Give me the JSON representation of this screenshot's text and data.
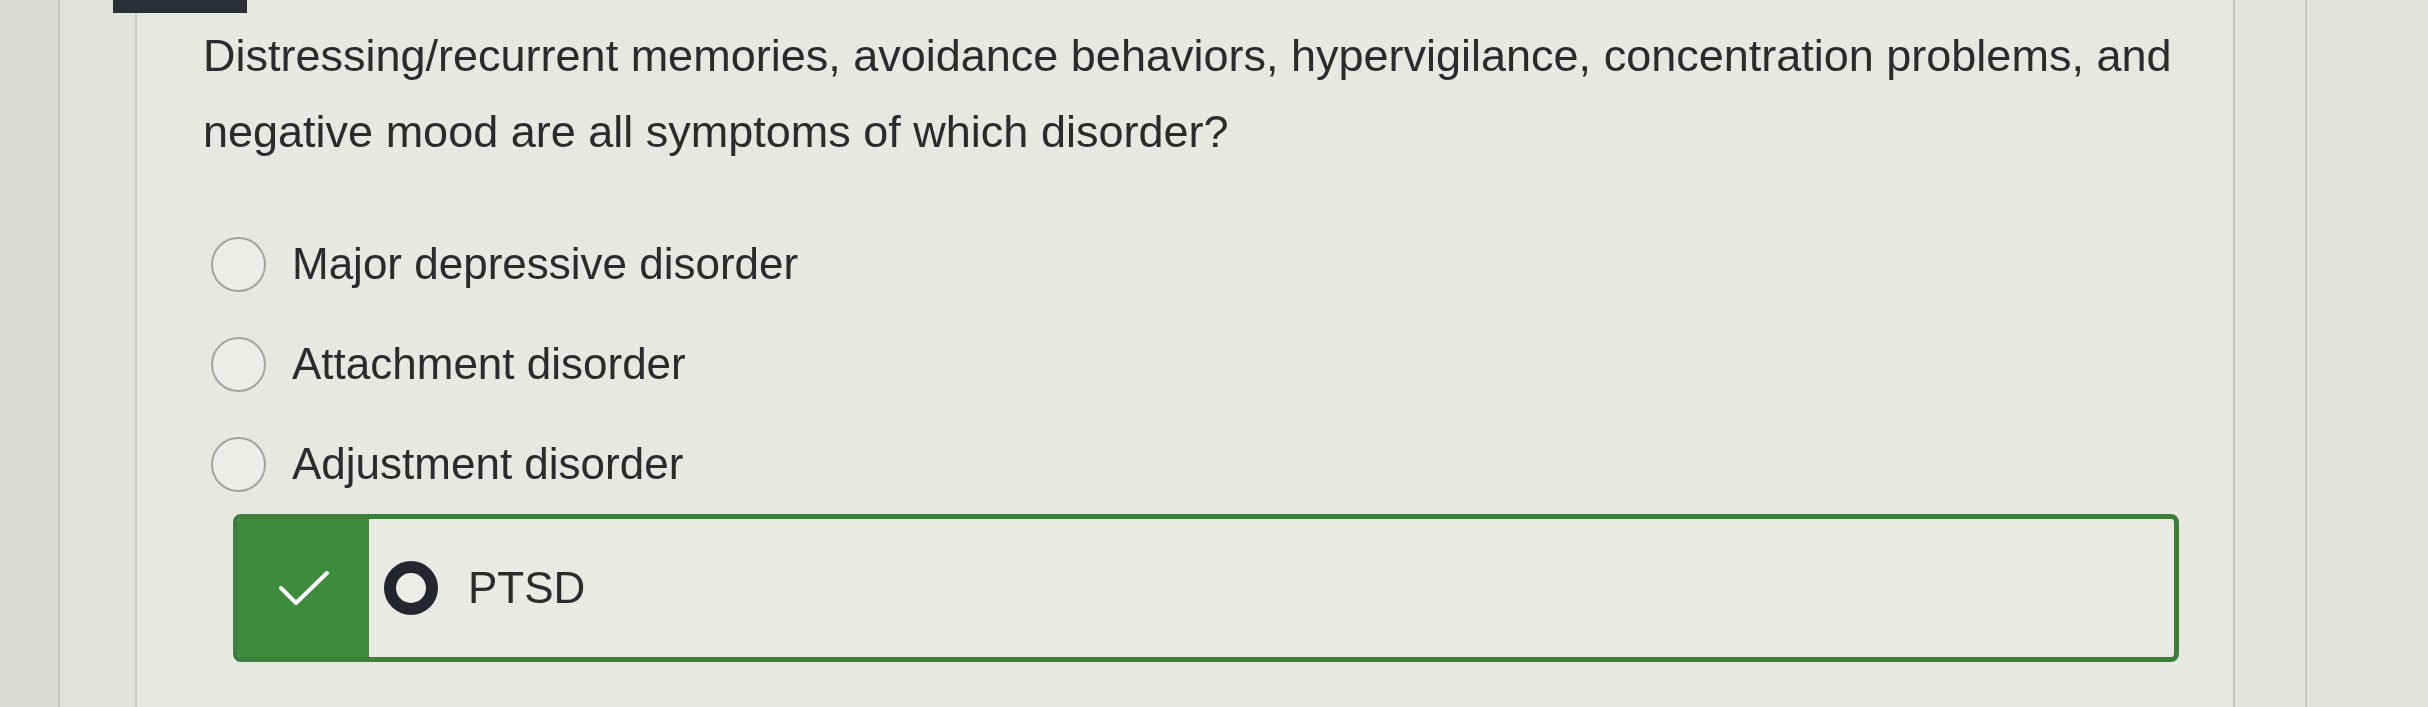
{
  "question": {
    "text": "Distressing/recurrent memories, avoidance behaviors, hypervigilance, concentration problems, and negative mood are all symptoms of which disorder?"
  },
  "options": [
    {
      "label": "Major depressive disorder",
      "selected": false,
      "correct": false
    },
    {
      "label": "Attachment disorder",
      "selected": false,
      "correct": false
    },
    {
      "label": "Adjustment disorder",
      "selected": false,
      "correct": false
    },
    {
      "label": "PTSD",
      "selected": true,
      "correct": true
    }
  ]
}
